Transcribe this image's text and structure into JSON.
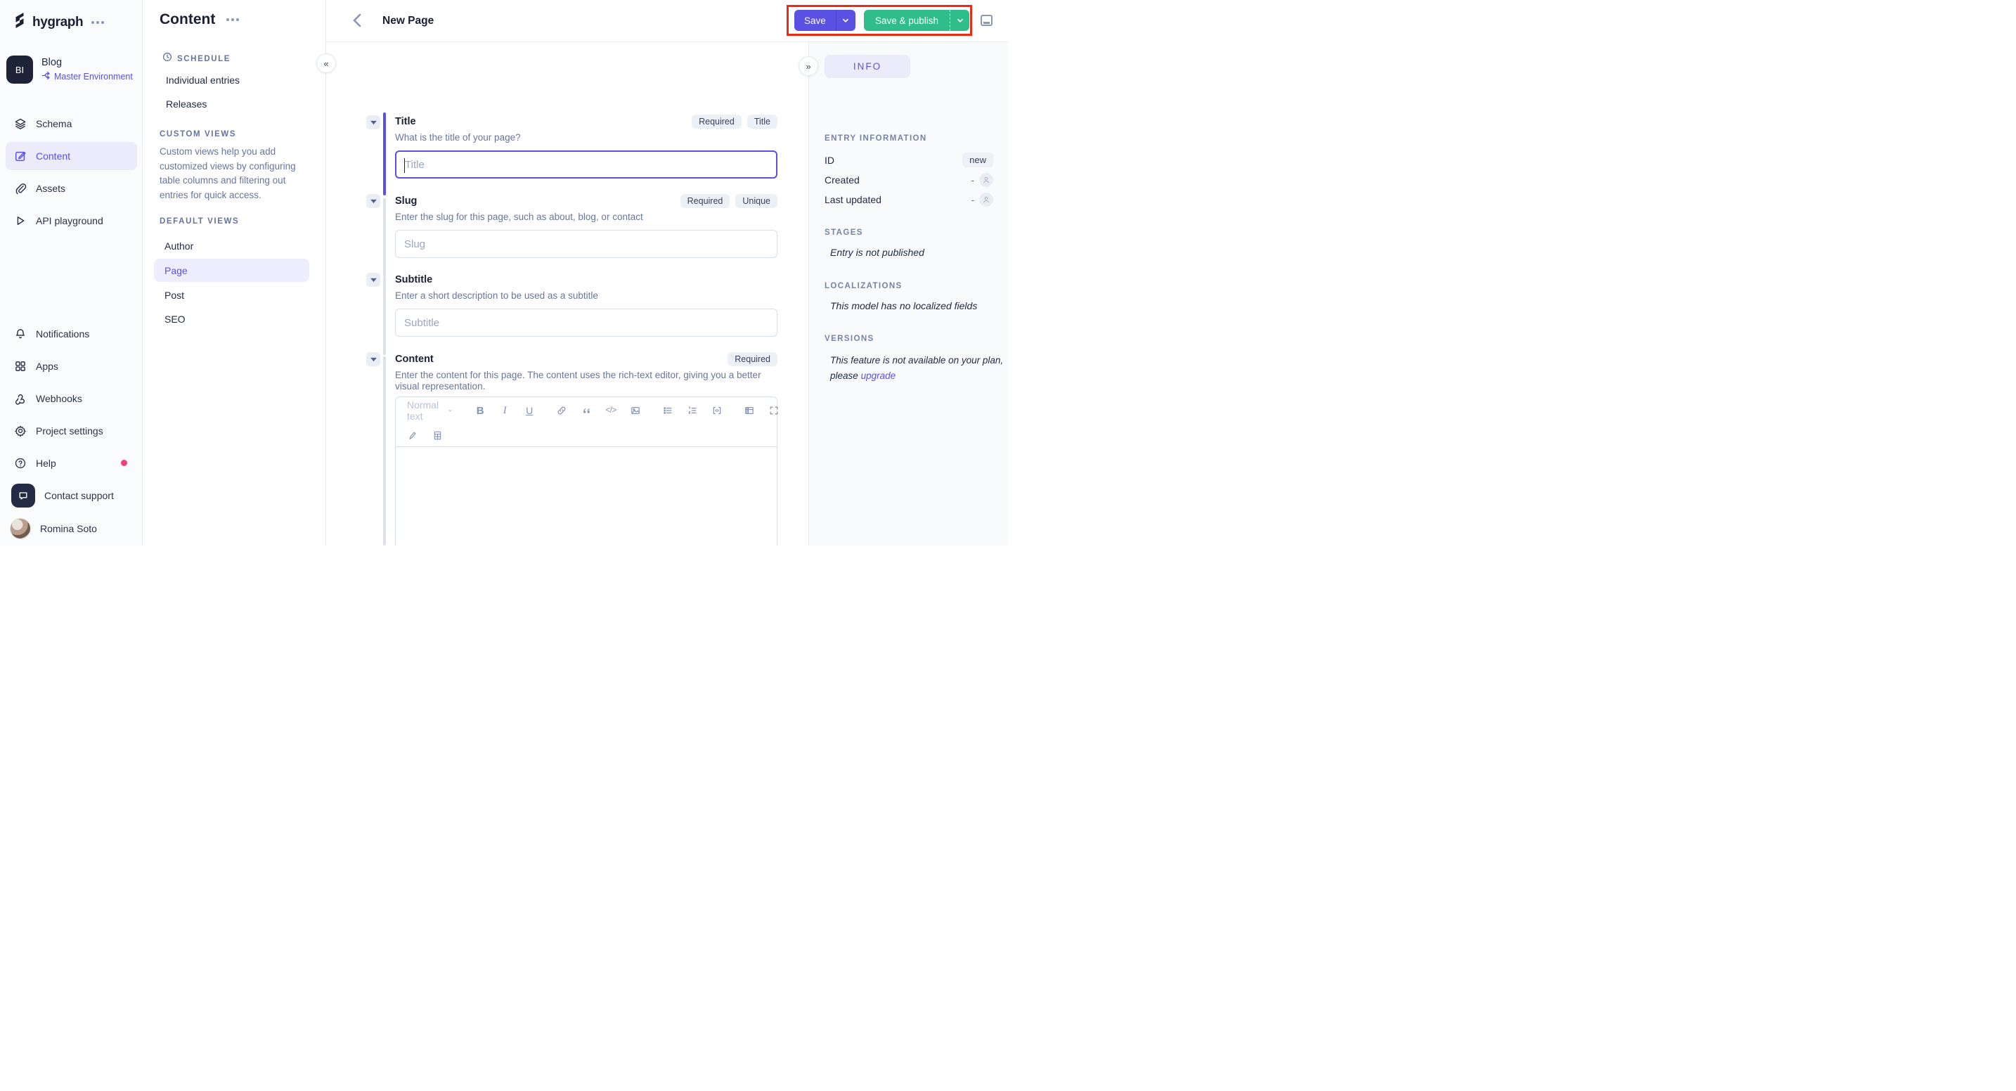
{
  "sidebar": {
    "brand": "hygraph",
    "project": {
      "initials": "BI",
      "name": "Blog",
      "environment": "Master Environment"
    },
    "nav": [
      {
        "label": "Schema"
      },
      {
        "label": "Content",
        "active": true
      },
      {
        "label": "Assets"
      },
      {
        "label": "API playground"
      }
    ],
    "bottom": [
      {
        "label": "Notifications"
      },
      {
        "label": "Apps"
      },
      {
        "label": "Webhooks"
      },
      {
        "label": "Project settings"
      },
      {
        "label": "Help"
      },
      {
        "label": "Contact support"
      }
    ],
    "user": {
      "name": "Romina Soto"
    }
  },
  "panel": {
    "title": "Content",
    "schedule": {
      "header": "SCHEDULE",
      "items": [
        "Individual entries",
        "Releases"
      ]
    },
    "custom_views": {
      "header": "CUSTOM VIEWS",
      "description": "Custom views help you add customized views by configuring table columns and filtering out entries for quick access."
    },
    "default_views": {
      "header": "DEFAULT VIEWS",
      "items": [
        "Author",
        "Page",
        "Post",
        "SEO"
      ],
      "selected": "Page"
    }
  },
  "header": {
    "title": "New Page",
    "save_label": "Save",
    "save_publish_label": "Save & publish"
  },
  "form": {
    "editor": {
      "paragraph_style": "Normal text"
    },
    "fields": [
      {
        "label": "Title",
        "badges": [
          "Required",
          "Title"
        ],
        "helper": "What is the title of your page?",
        "placeholder": "Title"
      },
      {
        "label": "Slug",
        "badges": [
          "Required",
          "Unique"
        ],
        "helper": "Enter the slug for this page, such as about, blog, or contact",
        "placeholder": "Slug"
      },
      {
        "label": "Subtitle",
        "badges": [],
        "helper": "Enter a short description to be used as a subtitle",
        "placeholder": "Subtitle"
      },
      {
        "label": "Content",
        "badges": [
          "Required"
        ],
        "helper": "Enter the content for this page. The content uses the rich-text editor, giving you a better visual representation."
      }
    ]
  },
  "info": {
    "tab": "INFO",
    "entry": {
      "header": "ENTRY INFORMATION",
      "rows": [
        {
          "label": "ID",
          "value": "new"
        },
        {
          "label": "Created",
          "value": "-"
        },
        {
          "label": "Last updated",
          "value": "-"
        }
      ]
    },
    "stages": {
      "header": "STAGES",
      "text": "Entry is not published"
    },
    "localizations": {
      "header": "LOCALIZATIONS",
      "text": "This model has no localized fields"
    },
    "versions": {
      "header": "VERSIONS",
      "text": "This feature is not available on your plan, please",
      "link": "upgrade"
    }
  },
  "colors": {
    "accent_purple": "#5B50E1",
    "publish_green": "#2EBD8B",
    "annotation_red": "#EE2B12",
    "notification_pink": "#F43F7F",
    "dark_navy": "#1A2134"
  }
}
